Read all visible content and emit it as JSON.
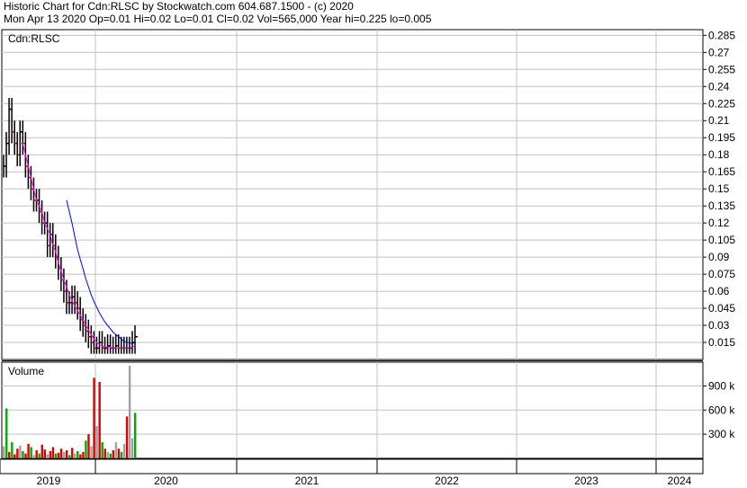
{
  "header": {
    "line1": "Historic Chart for Cdn:RLSC by Stockwatch.com 604.687.1500 - (c) 2020",
    "line2": "Mon Apr 13 2020   Op=0.01   Hi=0.02   Lo=0.01   Cl=0.02   Vol=565,000   Year hi=0.225   lo=0.005"
  },
  "colors": {
    "grid": "#c0c0c0",
    "frame": "#000000",
    "ma_short": "#ff00ff",
    "ma_long": "#0000ff",
    "price_up": "#000000",
    "price_down": "#cc0000",
    "vol_up": "#00aa00",
    "vol_down": "#dd0000",
    "vol_flat": "#a0a0a0"
  },
  "chart_data": [
    {
      "type": "line",
      "title": "Cdn:RLSC",
      "ylim": [
        0.0,
        0.29
      ],
      "y_ticks": [
        "0.285",
        "0.27",
        "0.255",
        "0.24",
        "0.225",
        "0.21",
        "0.195",
        "0.18",
        "0.165",
        "0.15",
        "0.135",
        "0.12",
        "0.105",
        "0.09",
        "0.075",
        "0.06",
        "0.045",
        "0.03",
        "0.015"
      ],
      "x_labels": [
        "2019",
        "2020",
        "2021",
        "2022",
        "2023",
        "2024"
      ],
      "series": [
        {
          "values": [
            0.17,
            0.19,
            0.22,
            0.2,
            0.19,
            0.18,
            0.2,
            0.19,
            0.17,
            0.16,
            0.15,
            0.14,
            0.14,
            0.13,
            0.12,
            0.12,
            0.1,
            0.11,
            0.1,
            0.09,
            0.08,
            0.07,
            0.06,
            0.05,
            0.05,
            0.055,
            0.05,
            0.045,
            0.035,
            0.03,
            0.025,
            0.02,
            0.015,
            0.01,
            0.01,
            0.015,
            0.01,
            0.01,
            0.012,
            0.01,
            0.01,
            0.012,
            0.01,
            0.01,
            0.01,
            0.01,
            0.01,
            0.015,
            0.02
          ]
        },
        {
          "values": [
            null,
            null,
            null,
            null,
            null,
            null,
            0.19,
            0.19,
            0.18,
            0.17,
            0.16,
            0.15,
            0.14,
            0.135,
            0.13,
            0.12,
            0.115,
            0.11,
            0.1,
            0.095,
            0.085,
            0.078,
            0.07,
            0.064,
            0.057,
            0.052,
            0.047,
            0.043,
            0.039,
            0.035,
            0.03,
            0.026,
            0.022,
            0.018,
            0.015,
            0.013,
            0.012,
            0.011,
            0.011,
            0.011,
            0.01,
            0.01,
            0.01,
            0.01,
            0.01,
            0.01,
            0.01,
            0.011,
            0.012
          ]
        },
        {
          "values": [
            null,
            null,
            null,
            null,
            null,
            null,
            null,
            null,
            null,
            null,
            null,
            null,
            null,
            null,
            null,
            null,
            null,
            null,
            null,
            null,
            null,
            null,
            null,
            0.14,
            0.13,
            0.12,
            0.108,
            0.097,
            0.088,
            0.08,
            0.071,
            0.064,
            0.057,
            0.051,
            0.046,
            0.041,
            0.037,
            0.033,
            0.03,
            0.027,
            0.024,
            0.022,
            0.02,
            0.018,
            0.016,
            0.015,
            0.015,
            0.014,
            0.015
          ]
        }
      ]
    },
    {
      "type": "bar",
      "title": "Volume",
      "ylim": [
        0,
        1150000
      ],
      "y_ticks": [
        "900 k",
        "600 k",
        "300 k"
      ],
      "values": [
        150000,
        620000,
        80000,
        200000,
        50000,
        120000,
        160000,
        90000,
        60000,
        180000,
        140000,
        40000,
        100000,
        60000,
        170000,
        110000,
        50000,
        90000,
        140000,
        60000,
        70000,
        120000,
        80000,
        100000,
        40000,
        130000,
        60000,
        90000,
        50000,
        80000,
        220000,
        300000,
        150000,
        1000000,
        400000,
        950000,
        200000,
        120000,
        80000,
        60000,
        100000,
        200000,
        120000,
        80000,
        180000,
        520000,
        1150000,
        250000,
        565000
      ],
      "directions": [
        "flat",
        "up",
        "down",
        "up",
        "down",
        "down",
        "flat",
        "up",
        "down",
        "down",
        "up",
        "flat",
        "down",
        "up",
        "down",
        "down",
        "flat",
        "down",
        "down",
        "up",
        "down",
        "down",
        "flat",
        "down",
        "up",
        "down",
        "flat",
        "up",
        "down",
        "down",
        "up",
        "down",
        "flat",
        "down",
        "flat",
        "down",
        "up",
        "down",
        "flat",
        "up",
        "down",
        "flat",
        "down",
        "up",
        "flat",
        "down",
        "flat",
        "flat",
        "up"
      ]
    }
  ]
}
